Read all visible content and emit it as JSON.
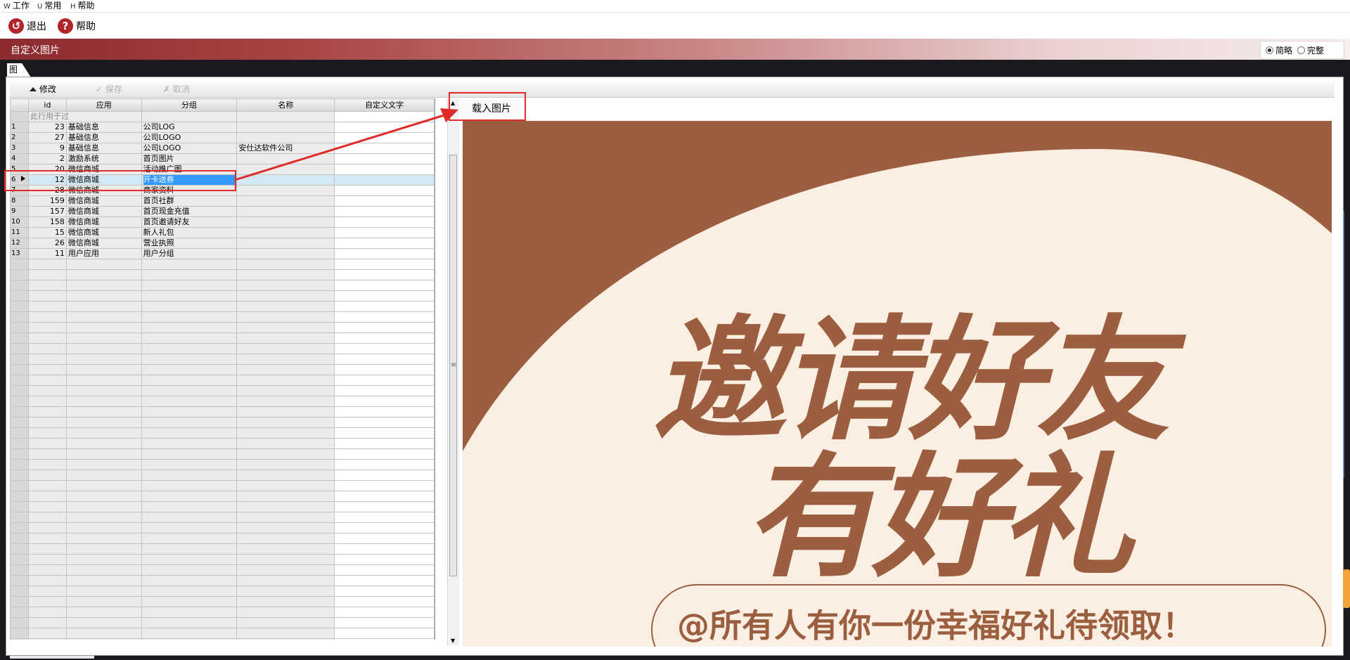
{
  "menu": [
    {
      "key": "W",
      "label": "工作"
    },
    {
      "key": "U",
      "label": "常用"
    },
    {
      "key": "H",
      "label": "帮助"
    }
  ],
  "toolbar": {
    "exit_label": "退出",
    "help_label": "帮助"
  },
  "title": "自定义图片",
  "view_options": [
    {
      "label": "简略",
      "selected": true
    },
    {
      "label": "完整",
      "selected": false
    }
  ],
  "tab_label": "图",
  "grid_toolbar": {
    "edit_label": "修改",
    "save_label": "保存",
    "cancel_label": "取消"
  },
  "grid": {
    "columns": [
      "id",
      "应用",
      "分组",
      "名称",
      "自定义文字"
    ],
    "description_row": "此行用于过",
    "rows": [
      {
        "n": "1",
        "id": "23",
        "app": "基础信息",
        "group": "公司LOG",
        "name": "",
        "text": ""
      },
      {
        "n": "2",
        "id": "27",
        "app": "基础信息",
        "group": "公司LOGO",
        "name": "",
        "text": ""
      },
      {
        "n": "3",
        "id": "9",
        "app": "基础信息",
        "group": "公司LOGO",
        "name": "安仕达软件公司",
        "text": ""
      },
      {
        "n": "4",
        "id": "2",
        "app": "激励系统",
        "group": "首页图片",
        "name": "",
        "text": ""
      },
      {
        "n": "5",
        "id": "20",
        "app": "微信商城",
        "group": "活动推广图",
        "name": "",
        "text": ""
      },
      {
        "n": "6",
        "id": "12",
        "app": "微信商城",
        "group": "开卡送券",
        "name": "",
        "text": ""
      },
      {
        "n": "7",
        "id": "28",
        "app": "微信商城",
        "group": "商家资料",
        "name": "",
        "text": ""
      },
      {
        "n": "8",
        "id": "159",
        "app": "微信商城",
        "group": "首页社群",
        "name": "",
        "text": ""
      },
      {
        "n": "9",
        "id": "157",
        "app": "微信商城",
        "group": "首页现金充值",
        "name": "",
        "text": ""
      },
      {
        "n": "10",
        "id": "158",
        "app": "微信商城",
        "group": "首页邀请好友",
        "name": "",
        "text": ""
      },
      {
        "n": "11",
        "id": "15",
        "app": "微信商城",
        "group": "新人礼包",
        "name": "",
        "text": ""
      },
      {
        "n": "12",
        "id": "26",
        "app": "微信商城",
        "group": "营业执照",
        "name": "",
        "text": ""
      },
      {
        "n": "13",
        "id": "11",
        "app": "用户应用",
        "group": "用户分组",
        "name": "",
        "text": ""
      }
    ],
    "selected_row": 6,
    "empty_rows": 40
  },
  "load_image_label": "载入图片",
  "poster": {
    "line1": "邀请好友",
    "line2": "有好礼",
    "subtitle": "@所有人有你一份幸福好礼待领取！",
    "brown": "#9b5e3f",
    "cream": "#fbefe4"
  },
  "colors": {
    "title_gradient_start": "#8d2a2e",
    "highlight": "#e02b2b",
    "selection": "#3399ff",
    "selected_row_bg": "#d3e7f5"
  }
}
